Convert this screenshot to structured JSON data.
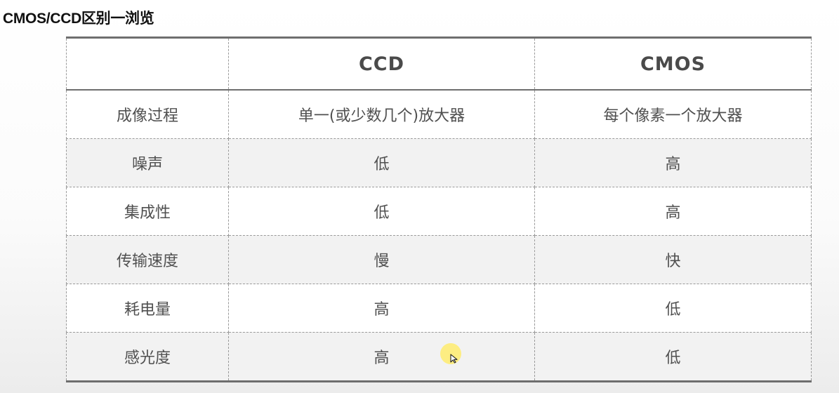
{
  "title": "CMOS/CCD区别一浏览",
  "table": {
    "headers": [
      "",
      "CCD",
      "CMOS"
    ],
    "rows": [
      [
        "成像过程",
        "单一(或少数几个)放大器",
        "每个像素一个放大器"
      ],
      [
        "噪声",
        "低",
        "高"
      ],
      [
        "集成性",
        "低",
        "高"
      ],
      [
        "传输速度",
        "慢",
        "快"
      ],
      [
        "耗电量",
        "高",
        "低"
      ],
      [
        "感光度",
        "高",
        "低"
      ]
    ]
  },
  "cursor": {
    "icon": "mouse-pointer-icon",
    "highlight_color": "#fde96e"
  }
}
